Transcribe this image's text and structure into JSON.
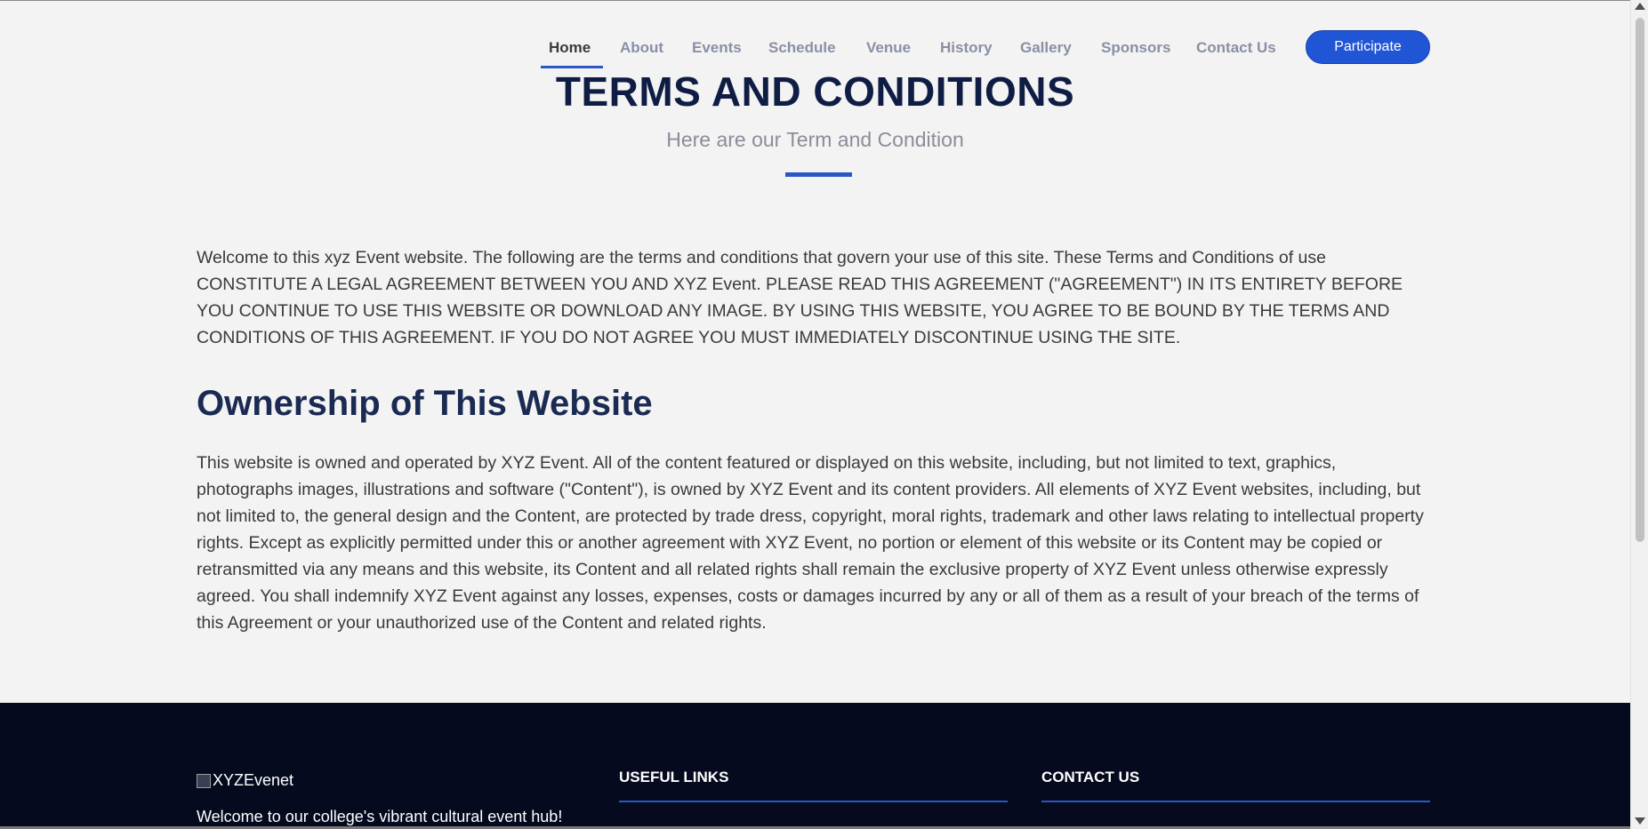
{
  "nav": {
    "items": [
      "Home",
      "About",
      "Events",
      "Schedule",
      "Venue",
      "History",
      "Gallery",
      "Sponsors",
      "Contact Us"
    ],
    "participate_label": "Participate"
  },
  "hero": {
    "title": "TERMS AND CONDITIONS",
    "subtitle": "Here are our Term and Condition"
  },
  "content": {
    "intro": "Welcome to this xyz Event website. The following are the terms and conditions that govern your use of this site. These Terms and Conditions of use CONSTITUTE A LEGAL AGREEMENT BETWEEN YOU AND XYZ Event. PLEASE READ THIS AGREEMENT (\"AGREEMENT\") IN ITS ENTIRETY BEFORE YOU CONTINUE TO USE THIS WEBSITE OR DOWNLOAD ANY IMAGE. BY USING THIS WEBSITE, YOU AGREE TO BE BOUND BY THE TERMS AND CONDITIONS OF THIS AGREEMENT. IF YOU DO NOT AGREE YOU MUST IMMEDIATELY DISCONTINUE USING THE SITE.",
    "ownership_heading": "Ownership of This Website",
    "ownership_text": "This website is owned and operated by XYZ Event. All of the content featured or displayed on this website, including, but not limited to text, graphics, photographs images, illustrations and software (\"Content\"), is owned by XYZ Event and its content providers. All elements of XYZ Event websites, including, but not limited to, the general design and the Content, are protected by trade dress, copyright, moral rights, trademark and other laws relating to intellectual property rights. Except as explicitly permitted under this or another agreement with XYZ Event, no portion or element of this website or its Content may be copied or retransmitted via any means and this website, its Content and all related rights shall remain the exclusive property of XYZ Event unless otherwise expressly agreed. You shall indemnify XYZ Event against any losses, expenses, costs or damages incurred by any or all of them as a result of your breach of the terms of this Agreement or your unauthorized use of the Content and related rights."
  },
  "footer": {
    "logo_alt": "XYZEvenet",
    "welcome": "Welcome to our college's vibrant cultural event hub!",
    "useful_links_heading": "USEFUL LINKS",
    "contact_heading": "CONTACT US"
  },
  "colors": {
    "accent": "#2a56c6",
    "button": "#2056d6",
    "footer_bg": "#050a1e",
    "title": "#0f1d44"
  }
}
